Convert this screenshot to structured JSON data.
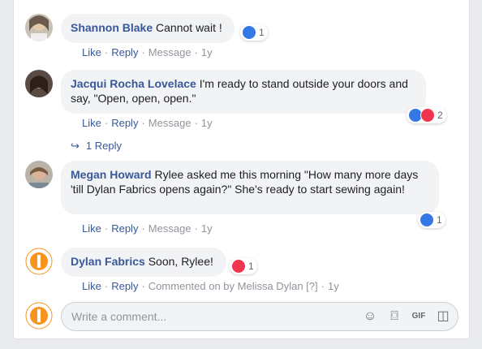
{
  "comments": [
    {
      "author": "Shannon Blake",
      "text": "Cannot wait !",
      "actions": {
        "like": "Like",
        "reply": "Reply",
        "message": "Message",
        "time": "1y"
      },
      "react_count": "1"
    },
    {
      "author": "Jacqui Rocha Lovelace",
      "text": "I'm ready to stand outside your doors and say, \"Open, open, open.\"",
      "actions": {
        "like": "Like",
        "reply": "Reply",
        "message": "Message",
        "time": "1y"
      },
      "react_count": "2",
      "replies_label": "1 Reply"
    },
    {
      "author": "Megan Howard",
      "text": "Rylee asked me this morning \"How many more days 'till Dylan Fabrics opens again?\" She's ready to start sewing again!",
      "actions": {
        "like": "Like",
        "reply": "Reply",
        "message": "Message",
        "time": "1y"
      },
      "react_count": "1"
    },
    {
      "author": "Dylan Fabrics",
      "text": "Soon, Rylee!",
      "actions": {
        "like": "Like",
        "reply": "Reply",
        "commented_on": "Commented on by Melissa Dylan",
        "help": "[?]",
        "time": "1y"
      },
      "react_count": "1"
    }
  ],
  "composer": {
    "placeholder": "Write a comment..."
  },
  "colors": {
    "author_link": "#385898",
    "like_blue": "#3578e5",
    "love_red": "#f0364e",
    "brand_orange": "#f7941d"
  }
}
